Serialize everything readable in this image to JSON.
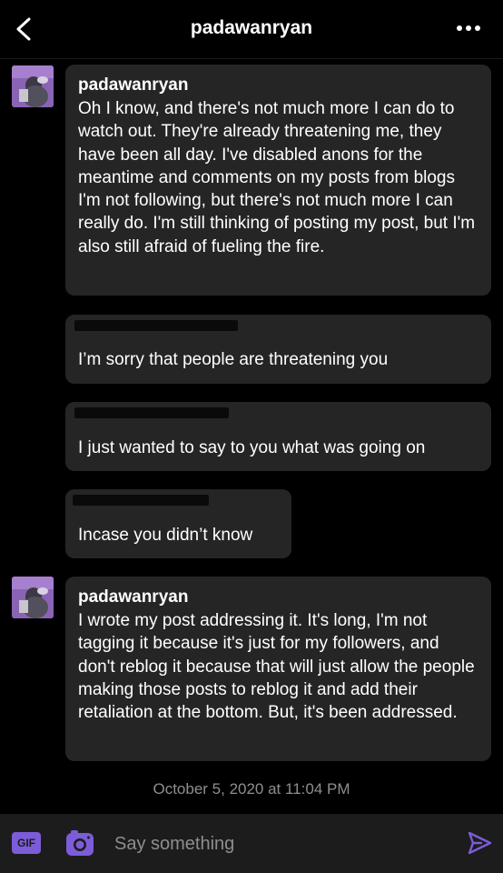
{
  "header": {
    "title": "padawanryan",
    "back_icon": "chevron-left-icon",
    "more_icon": "more-dots-icon"
  },
  "messages": [
    {
      "sender": "padawanryan",
      "text": "Oh I know, and there's not much more I can do to watch out. They're already threatening me, they have been all day. I've disabled anons for the meantime and comments on my posts from blogs I'm not following, but there's not much more I can really do. I'm still thinking of posting my post, but I'm also still afraid of fueling the fire."
    },
    {
      "text": "I’m sorry that people are threatening you"
    },
    {
      "text": "I just wanted to say to you what was going on"
    },
    {
      "text": "Incase you didn’t know"
    },
    {
      "sender": "padawanryan",
      "text": "I wrote my post addressing it. It's long, I'm not tagging it because it's just for my followers, and don't reblog it because that will just allow the people making those posts to reblog it and add their retaliation at the bottom. But, it's been addressed."
    }
  ],
  "timestamp": "October 5, 2020 at 11:04 PM",
  "composer": {
    "gif_label": "GIF",
    "placeholder": "Say something",
    "accent_color": "#7c5cd8"
  }
}
